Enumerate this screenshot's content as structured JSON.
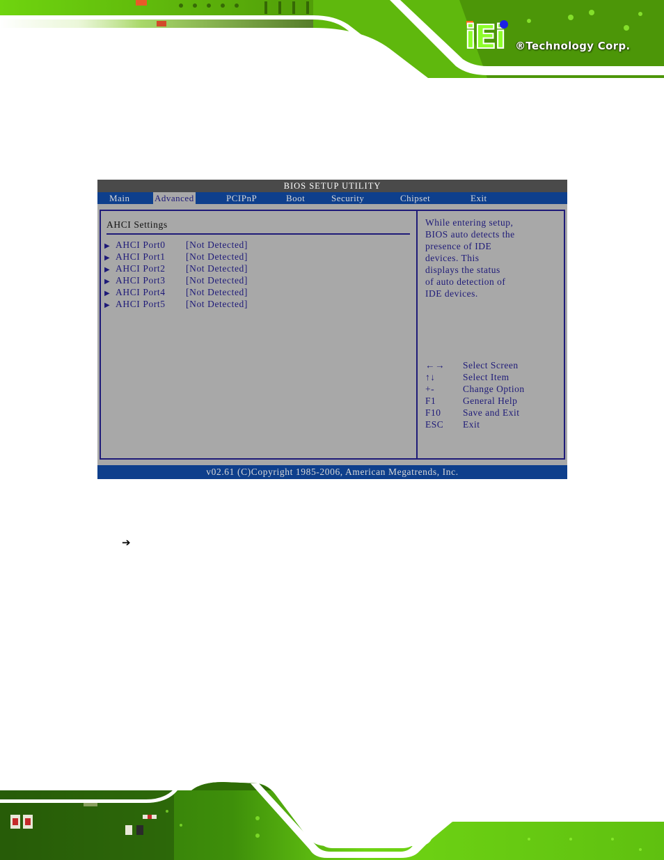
{
  "header": {
    "logo_mark": "iEi",
    "logo_text": "®Technology Corp."
  },
  "bios": {
    "title": "BIOS SETUP UTILITY",
    "menu": [
      {
        "label": "Main",
        "active": false
      },
      {
        "label": "Advanced",
        "active": true
      },
      {
        "label": "PCIPnP",
        "active": false
      },
      {
        "label": "Boot",
        "active": false
      },
      {
        "label": "Security",
        "active": false
      },
      {
        "label": "Chipset",
        "active": false
      },
      {
        "label": "Exit",
        "active": false
      }
    ],
    "section_title": "AHCI Settings",
    "ports": [
      {
        "arrow": "▶",
        "name": "AHCI Port0",
        "status": "[Not Detected]"
      },
      {
        "arrow": "▶",
        "name": "AHCI Port1",
        "status": "[Not Detected]"
      },
      {
        "arrow": "▶",
        "name": "AHCI Port2",
        "status": "[Not Detected]"
      },
      {
        "arrow": "▶",
        "name": "AHCI Port3",
        "status": "[Not Detected]"
      },
      {
        "arrow": "▶",
        "name": "AHCI Port4",
        "status": "[Not Detected]"
      },
      {
        "arrow": "▶",
        "name": "AHCI Port5",
        "status": "[Not Detected]"
      }
    ],
    "help_lines": [
      "While entering setup,",
      "BIOS auto detects the",
      "presence of IDE",
      "devices. This",
      "displays the status",
      "of auto detection of",
      "IDE devices."
    ],
    "keys": [
      {
        "key": "←→",
        "action": "Select Screen"
      },
      {
        "key": "↑↓",
        "action": "Select Item"
      },
      {
        "key": "+-",
        "action": "Change Option"
      },
      {
        "key": "F1",
        "action": "General Help"
      },
      {
        "key": "F10",
        "action": "Save and Exit"
      },
      {
        "key": "ESC",
        "action": "Exit"
      }
    ],
    "footer": "v02.61 (C)Copyright 1985-2006, American Megatrends, Inc.",
    "colors": {
      "title_bar": "#4a4a4a",
      "menu_bar": "#0e3f8c",
      "panel_bg": "#a8a8a8",
      "text": "#1e1a78"
    }
  },
  "body": {
    "bullet_icon": "arrow-right-icon",
    "bullet_glyph": "➔"
  }
}
